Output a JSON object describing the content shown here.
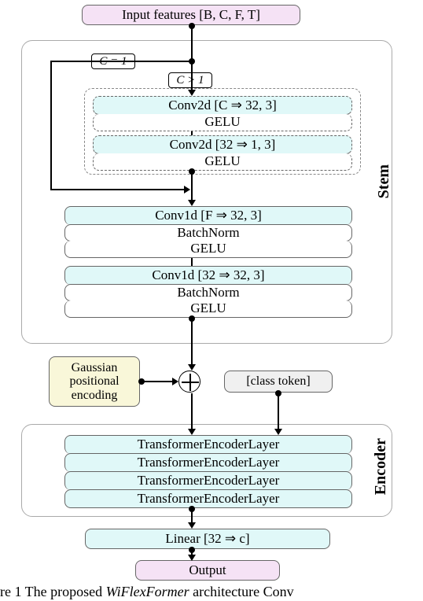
{
  "input": "Input features [B, C, F, T]",
  "cond_eq": "C = 1",
  "cond_gt": "C > 1",
  "stem": {
    "conv2d_1": "Conv2d [C ⇒ 32, 3]",
    "gelu1": "GELU",
    "conv2d_2": "Conv2d [32 ⇒ 1, 3]",
    "gelu2": "GELU",
    "conv1d_1": "Conv1d [F ⇒ 32, 3]",
    "bn1": "BatchNorm",
    "gelu3": "GELU",
    "conv1d_2": "Conv1d [32 ⇒ 32, 3]",
    "bn2": "BatchNorm",
    "gelu4": "GELU",
    "label": "Stem"
  },
  "pos_enc": "Gaussian positional encoding",
  "class_token": "[class token]",
  "encoder": {
    "l1": "TransformerEncoderLayer",
    "l2": "TransformerEncoderLayer",
    "l3": "TransformerEncoderLayer",
    "l4": "TransformerEncoderLayer",
    "label": "Encoder"
  },
  "linear": "Linear [32 ⇒ c]",
  "output": "Output",
  "caption_prefix": "re 1   The proposed ",
  "caption_ital": "WiFlexFormer ",
  "caption_suffix": "architecture  Conv",
  "chart_data": {
    "type": "flow-diagram",
    "nodes": [
      {
        "id": "in",
        "label": "Input features [B, C, F, T]"
      },
      {
        "id": "branch",
        "condition": "C > 1",
        "bypass_when": "C = 1"
      },
      {
        "id": "c2a",
        "label": "Conv2d [C ⇒ 32, 3]"
      },
      {
        "id": "g1",
        "label": "GELU"
      },
      {
        "id": "c2b",
        "label": "Conv2d [32 ⇒ 1, 3]"
      },
      {
        "id": "g2",
        "label": "GELU"
      },
      {
        "id": "c1a",
        "label": "Conv1d [F ⇒ 32, 3]"
      },
      {
        "id": "bn1",
        "label": "BatchNorm"
      },
      {
        "id": "g3",
        "label": "GELU"
      },
      {
        "id": "c1b",
        "label": "Conv1d [32 ⇒ 32, 3]"
      },
      {
        "id": "bn2",
        "label": "BatchNorm"
      },
      {
        "id": "g4",
        "label": "GELU"
      },
      {
        "id": "add",
        "op": "+",
        "inputs_side": [
          "Gaussian positional encoding"
        ]
      },
      {
        "id": "enc",
        "layers": [
          "TransformerEncoderLayer",
          "TransformerEncoderLayer",
          "TransformerEncoderLayer",
          "TransformerEncoderLayer"
        ],
        "side_input": "[class token]"
      },
      {
        "id": "lin",
        "label": "Linear [32 ⇒ c]"
      },
      {
        "id": "out",
        "label": "Output"
      }
    ],
    "groups": [
      {
        "name": "Stem",
        "members": [
          "c2a",
          "g1",
          "c2b",
          "g2",
          "c1a",
          "bn1",
          "g3",
          "c1b",
          "bn2",
          "g4"
        ]
      },
      {
        "name": "Encoder",
        "members": [
          "enc"
        ]
      }
    ],
    "edges": [
      [
        "in",
        "branch"
      ],
      [
        "branch",
        "c2a",
        "C > 1"
      ],
      [
        "branch",
        "c1a",
        "C = 1 (bypass)"
      ],
      [
        "c2a",
        "g1"
      ],
      [
        "g1",
        "c2b"
      ],
      [
        "c2b",
        "g2"
      ],
      [
        "g2",
        "c1a"
      ],
      [
        "c1a",
        "bn1"
      ],
      [
        "bn1",
        "g3"
      ],
      [
        "g3",
        "c1b"
      ],
      [
        "c1b",
        "bn2"
      ],
      [
        "bn2",
        "g4"
      ],
      [
        "g4",
        "add"
      ],
      [
        "Gaussian positional encoding",
        "add"
      ],
      [
        "add",
        "enc"
      ],
      [
        "[class token]",
        "enc"
      ],
      [
        "enc",
        "lin"
      ],
      [
        "lin",
        "out"
      ]
    ]
  }
}
